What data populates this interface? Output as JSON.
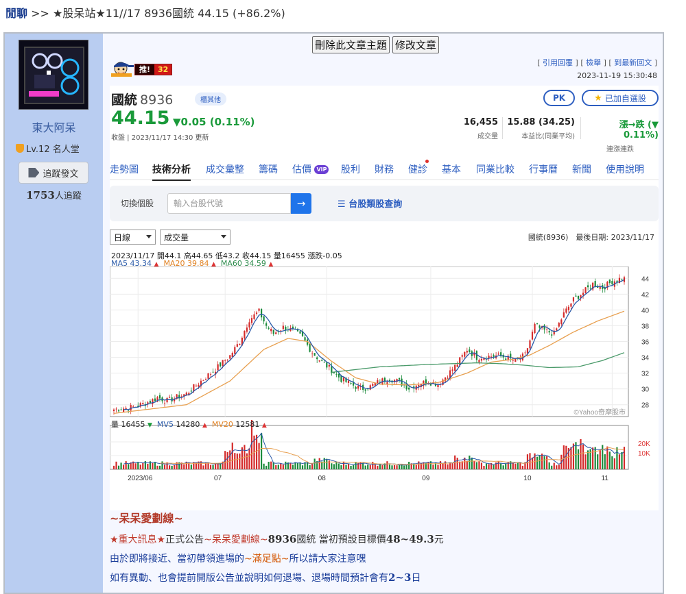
{
  "breadcrumb": {
    "forum": "閒聊",
    "sep": " >> ",
    "title": "★股呆站★11//17 8936國統 44.15 (+86.2%)"
  },
  "author": {
    "name": "東大阿呆",
    "level": "Lv.12",
    "rank": "名人堂",
    "follow_label": "追蹤發文",
    "followers": "1753",
    "followers_suffix": "人追蹤"
  },
  "admin": {
    "delete_label": "刪除此文章主題",
    "edit_label": "修改文章"
  },
  "push": {
    "label": "推!",
    "count": "32"
  },
  "quote_links": {
    "quote": "引用回覆",
    "report": "檢舉",
    "newest": "到最新回文"
  },
  "post_time": "2023-11-19 15:30:48",
  "stock": {
    "name": "國統",
    "code": "8936",
    "tag": "櫃其他",
    "pk_label": "PK",
    "add_label": "已加自選股",
    "price": "44.15",
    "change": "▼0.05 (0.11%)",
    "price_time": "收盤 | 2023/11/17 14:30 更新",
    "volume": {
      "value": "16,455",
      "label": "成交量"
    },
    "pe": {
      "value": "15.88 (34.25)",
      "label": "本益比(同業平均)"
    },
    "streak": {
      "value": "漲→跌 (▼ 0.11%)",
      "label": "連漲連跌"
    },
    "tabs": [
      "走勢圖",
      "技術分析",
      "成交彙整",
      "籌碼",
      "估價",
      "股利",
      "財務",
      "健診",
      "基本",
      "同業比較",
      "行事曆",
      "新聞",
      "使用說明"
    ],
    "vip_label": "VIP",
    "switch_label": "切換個股",
    "input_placeholder": "輸入台股代號",
    "category_link": "台股類股查詢",
    "period_select": "日線",
    "indicator_select": "成交量",
    "chart_meta": "國統(8936)　最後日期: 2023/11/17",
    "ohlc": "2023/11/17 開44.1 高44.65 低43.2 收44.15 量16455 漲跌-0.05",
    "ma": [
      {
        "label": "MA5",
        "value": "43.34"
      },
      {
        "label": "MA20",
        "value": "39.84"
      },
      {
        "label": "MA60",
        "value": "34.59"
      }
    ],
    "vol_info": [
      {
        "label": "量",
        "value": "16455"
      },
      {
        "label": "MV5",
        "value": "14280"
      },
      {
        "label": "MV20",
        "value": "12581"
      }
    ]
  },
  "chart_data": {
    "type": "candlestick",
    "series_names": [
      "MA5",
      "MA20",
      "MA60"
    ],
    "y_ticks": [
      28,
      30,
      32,
      34,
      36,
      38,
      40,
      42,
      44
    ],
    "ylim": [
      26.5,
      45.5
    ],
    "vol_ticks": [
      "10K",
      "20K"
    ],
    "x_ticks": [
      "2023/06",
      "07",
      "08",
      "09",
      "10",
      "11"
    ],
    "watermark": "©Yahoo奇摩股市",
    "close_path": [
      [
        0,
        27.4
      ],
      [
        8,
        27.7
      ],
      [
        14,
        28.3
      ],
      [
        18,
        28.9
      ],
      [
        22,
        28.5
      ],
      [
        30,
        29.4
      ],
      [
        36,
        31.0
      ],
      [
        42,
        32.5
      ],
      [
        48,
        34.2
      ],
      [
        52,
        36.0
      ],
      [
        56,
        38.8
      ],
      [
        60,
        39.8
      ],
      [
        63,
        38.0
      ],
      [
        66,
        37.0
      ],
      [
        70,
        37.8
      ],
      [
        74,
        37.4
      ],
      [
        78,
        36.5
      ],
      [
        82,
        34.6
      ],
      [
        86,
        33.4
      ],
      [
        90,
        32.4
      ],
      [
        94,
        31.2
      ],
      [
        98,
        30.6
      ],
      [
        102,
        30.0
      ],
      [
        106,
        30.3
      ],
      [
        110,
        31.0
      ],
      [
        114,
        31.3
      ],
      [
        118,
        30.9
      ],
      [
        122,
        30.1
      ],
      [
        126,
        30.7
      ],
      [
        130,
        30.9
      ],
      [
        134,
        30.6
      ],
      [
        138,
        31.8
      ],
      [
        142,
        33.2
      ],
      [
        146,
        35.0
      ],
      [
        150,
        34.0
      ],
      [
        154,
        34.1
      ],
      [
        158,
        34.2
      ],
      [
        162,
        34.0
      ],
      [
        166,
        33.5
      ],
      [
        170,
        34.3
      ],
      [
        174,
        38.0
      ],
      [
        178,
        37.4
      ],
      [
        182,
        37.0
      ],
      [
        186,
        39.5
      ],
      [
        190,
        41.3
      ],
      [
        194,
        42.2
      ],
      [
        198,
        43.3
      ],
      [
        202,
        42.8
      ],
      [
        206,
        43.6
      ],
      [
        211,
        44.15
      ]
    ],
    "ma20_path": [
      [
        0,
        26.9
      ],
      [
        30,
        28.0
      ],
      [
        48,
        31.0
      ],
      [
        62,
        35.0
      ],
      [
        72,
        36.4
      ],
      [
        80,
        36.0
      ],
      [
        90,
        33.5
      ],
      [
        100,
        31.4
      ],
      [
        110,
        30.6
      ],
      [
        122,
        30.5
      ],
      [
        134,
        30.8
      ],
      [
        146,
        32.0
      ],
      [
        156,
        33.4
      ],
      [
        164,
        33.7
      ],
      [
        172,
        34.3
      ],
      [
        180,
        35.5
      ],
      [
        190,
        37.2
      ],
      [
        200,
        38.6
      ],
      [
        211,
        39.84
      ]
    ],
    "ma60_path": [
      [
        90,
        32.1
      ],
      [
        110,
        32.8
      ],
      [
        130,
        33.1
      ],
      [
        150,
        33.3
      ],
      [
        160,
        33.2
      ],
      [
        170,
        33.0
      ],
      [
        180,
        32.7
      ],
      [
        192,
        32.8
      ],
      [
        202,
        33.6
      ],
      [
        211,
        34.59
      ]
    ]
  },
  "article": {
    "title": "~呆呆愛劃線~",
    "line1": {
      "a": "★重大訊息★",
      "b": "正式公告",
      "c": "~呆呆愛劃線~",
      "d": "8936",
      "e": "國統 當初預設目標價",
      "f": "48~49.3",
      "g": "元"
    },
    "line2": {
      "a": "由於即將接近、當初帶領進場的",
      "b": "~滿足點~",
      "c": "所以請大家注意嘿"
    },
    "line3": {
      "a": "如有異動、也會提前開版公告並說明如何退場、退場時間預計會有",
      "b": "2~3",
      "c": "日"
    }
  }
}
